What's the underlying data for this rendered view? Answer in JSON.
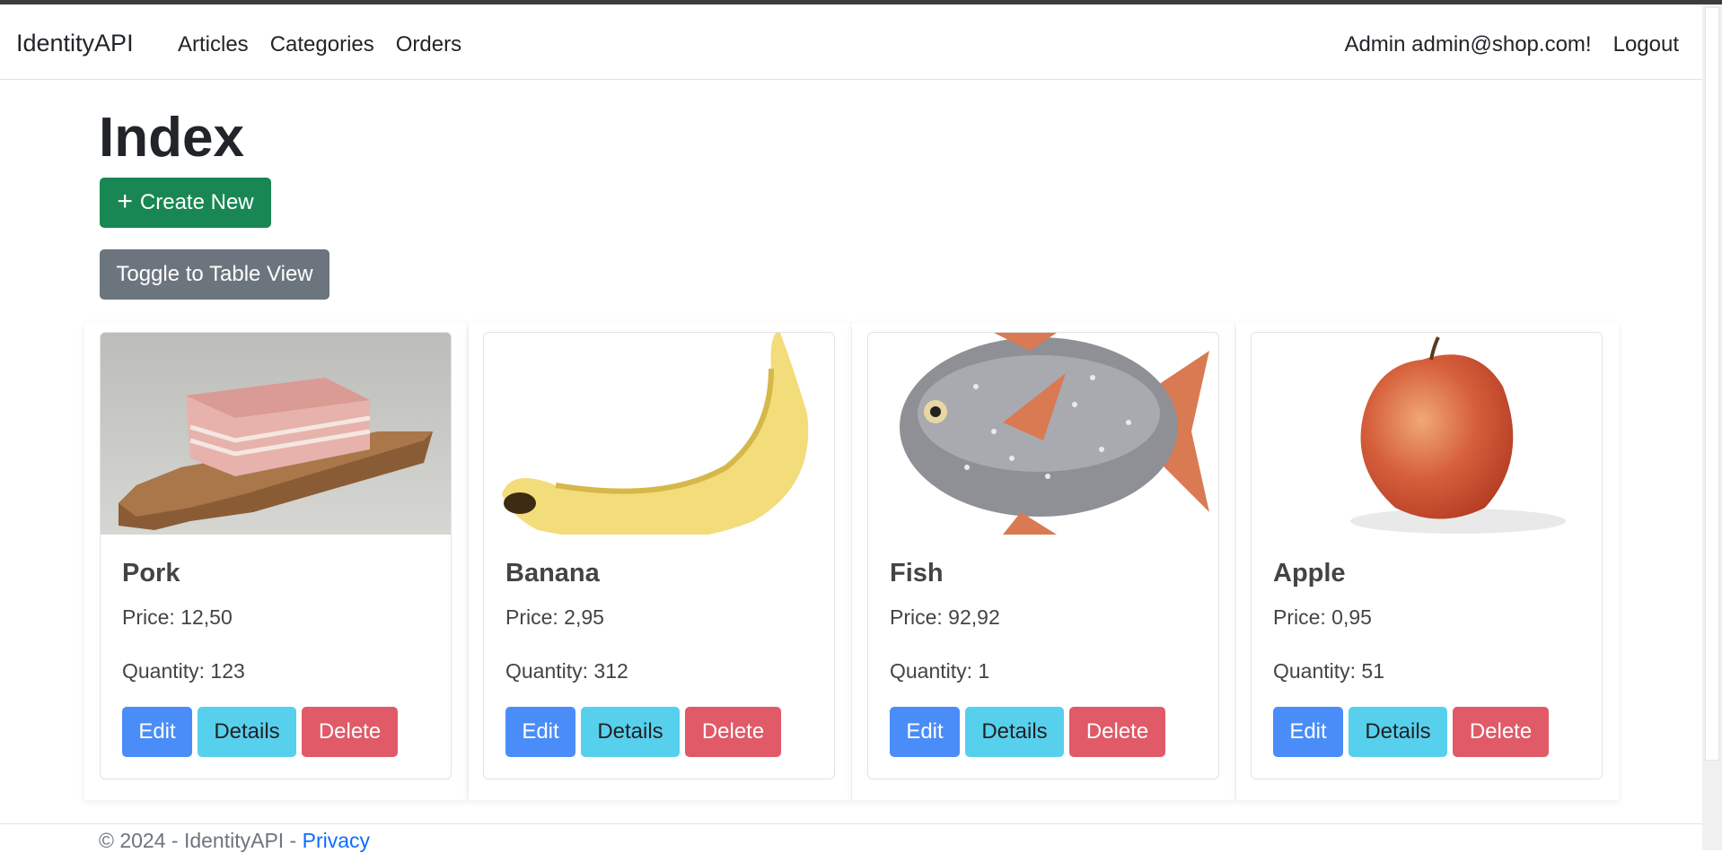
{
  "navbar": {
    "brand": "IdentityAPI",
    "links": [
      "Articles",
      "Categories",
      "Orders"
    ],
    "user_greeting": "Admin admin@shop.com!",
    "logout": "Logout"
  },
  "page": {
    "title": "Index",
    "create_label": "Create New",
    "toggle_label": "Toggle to Table View"
  },
  "cards": [
    {
      "name": "Pork",
      "price": "Price: 12,50",
      "quantity": "Quantity: 123",
      "image": "pork-on-cutting-board"
    },
    {
      "name": "Banana",
      "price": "Price: 2,95",
      "quantity": "Quantity: 312",
      "image": "banana"
    },
    {
      "name": "Fish",
      "price": "Price: 92,92",
      "quantity": "Quantity: 1",
      "image": "opah-fish"
    },
    {
      "name": "Apple",
      "price": "Price: 0,95",
      "quantity": "Quantity: 51",
      "image": "red-apple"
    }
  ],
  "card_buttons": {
    "edit": "Edit",
    "details": "Details",
    "delete": "Delete"
  },
  "footer": {
    "copyright": "© 2024 - IdentityAPI - ",
    "privacy": "Privacy"
  },
  "colors": {
    "create": "#198754",
    "toggle": "#6c757d",
    "edit": "#4a8df8",
    "details": "#57d0ee",
    "delete": "#e05a67",
    "link": "#0d6efd"
  }
}
